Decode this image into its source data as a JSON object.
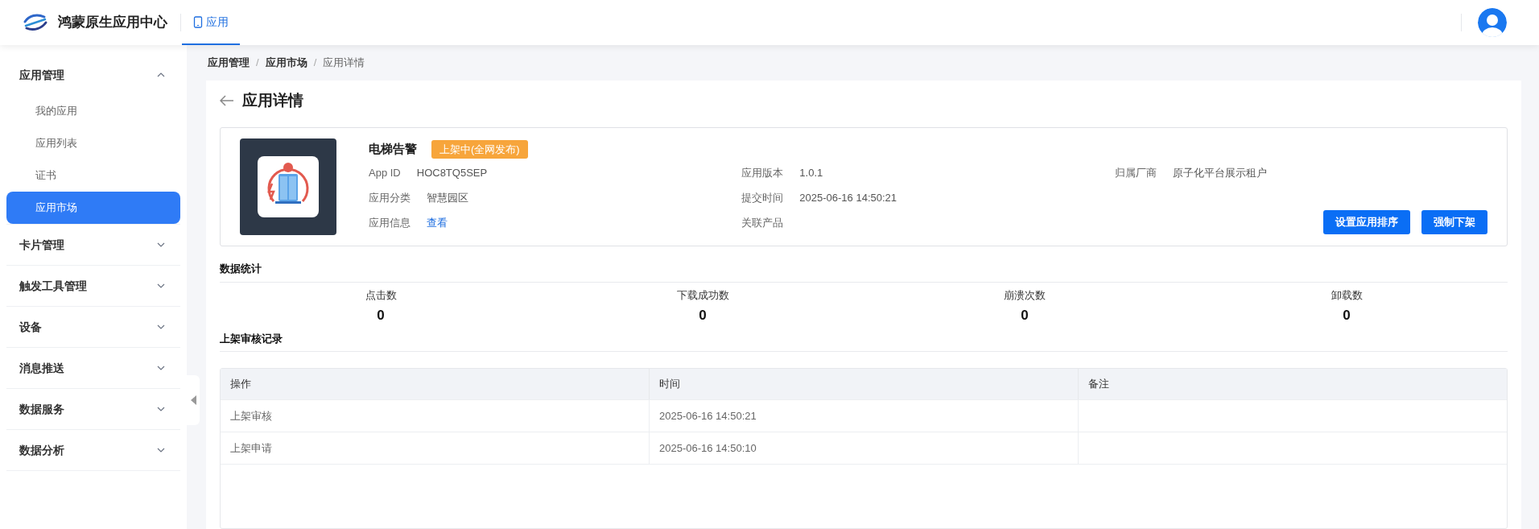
{
  "header": {
    "logo_title": "鸿蒙原生应用中心",
    "nav_tabs": [
      {
        "label": "应用",
        "selected": true
      }
    ]
  },
  "sidebar": {
    "groups": [
      {
        "label": "应用管理",
        "expanded": true,
        "items": [
          {
            "label": "我的应用",
            "selected": false
          },
          {
            "label": "应用列表",
            "selected": false
          },
          {
            "label": "证书",
            "selected": false
          },
          {
            "label": "应用市场",
            "selected": true
          }
        ]
      },
      {
        "label": "卡片管理",
        "expanded": false
      },
      {
        "label": "触发工具管理",
        "expanded": false
      },
      {
        "label": "设备",
        "expanded": false
      },
      {
        "label": "消息推送",
        "expanded": false
      },
      {
        "label": "数据服务",
        "expanded": false
      },
      {
        "label": "数据分析",
        "expanded": false
      }
    ]
  },
  "breadcrumb": {
    "separator": "/",
    "items": [
      {
        "label": "应用管理"
      },
      {
        "label": "应用市场"
      },
      {
        "label": "应用详情"
      }
    ]
  },
  "page_title": "应用详情",
  "app": {
    "name": "电梯告警",
    "status_badge": "上架中(全网发布)",
    "columns": [
      [
        {
          "label": "App ID",
          "value": "HOC8TQ5SEP",
          "kind": "text"
        },
        {
          "label": "应用分类",
          "value": "智慧园区",
          "kind": "text"
        },
        {
          "label": "应用信息",
          "value": "查看",
          "kind": "link"
        }
      ],
      [
        {
          "label": "应用版本",
          "value": "1.0.1",
          "kind": "text"
        },
        {
          "label": "提交时间",
          "value": "2025-06-16 14:50:21",
          "kind": "text"
        },
        {
          "label": "关联产品"
        }
      ],
      [
        {
          "label": "归属厂商",
          "value": "原子化平台展示租户",
          "kind": "text"
        }
      ]
    ],
    "buttons": [
      "设置应用排序",
      "强制下架"
    ]
  },
  "stats": {
    "title": "数据统计",
    "items": [
      {
        "label": "点击数",
        "value": "0"
      },
      {
        "label": "下载成功数",
        "value": "0"
      },
      {
        "label": "崩溃次数",
        "value": "0"
      },
      {
        "label": "卸载数",
        "value": "0"
      }
    ]
  },
  "audit": {
    "title": "上架审核记录",
    "columns": [
      "操作",
      "时间",
      "备注"
    ],
    "rows": [
      [
        "上架审核",
        "2025-06-16 14:50:21",
        ""
      ],
      [
        "上架申请",
        "2025-06-16 14:50:10",
        ""
      ]
    ]
  }
}
